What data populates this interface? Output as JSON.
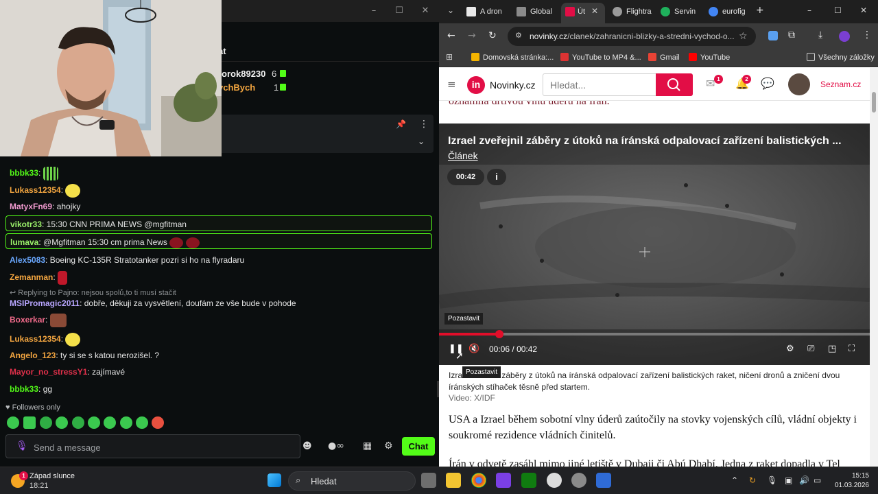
{
  "left_window": {
    "title_controls": [
      "–",
      "☐",
      "✕"
    ],
    "header_title": "at",
    "gifters": [
      {
        "name": "rorok89230",
        "count": "6",
        "color": "#f2f2f2"
      },
      {
        "name": "ychBych",
        "count": "1",
        "color": "#f4a640"
      }
    ],
    "messages": [
      {
        "user": "bbbk33",
        "color": "#53fc18",
        "text": "",
        "emote": "#6fd64a",
        "highlight": false
      },
      {
        "user": "Lukass12354",
        "color": "#f4a640",
        "text": "",
        "emote": "#f4e04a",
        "highlight": false
      },
      {
        "user": "MatyxFn69",
        "color": "#f29bd0",
        "text": "ahojky",
        "emote": "",
        "highlight": false
      },
      {
        "user": "vikotr33",
        "color": "#9cf26b",
        "text": "15:30 CNN PRIMA NEWS @mgfitman",
        "emote": "",
        "highlight": true
      },
      {
        "user": "lumava",
        "color": "#9cf26b",
        "text": "@Mgfitman 15:30 cm prima News",
        "emote": "#8a1420",
        "highlight": true
      },
      {
        "user": "Alex5083",
        "color": "#6aa8ff",
        "text": "Boeing KC-135R Stratotanker pozri si ho na flyradaru",
        "emote": "",
        "highlight": false
      },
      {
        "user": "Zemanman",
        "color": "#f4a640",
        "text": "",
        "emote": "#c0182a",
        "highlight": false
      },
      {
        "user": "MSIPromagic2011",
        "color": "#b8a6ff",
        "text": "dobře, děkuji za vysvětlení, doufám ze vše bude v pohode",
        "emote": "",
        "highlight": false,
        "reply": "Replying to Pajno: nejsou spolů,to ti musí stačit"
      },
      {
        "user": "Boxerkar",
        "color": "#f06a8a",
        "text": "",
        "emote": "#8a4a36",
        "highlight": false
      },
      {
        "user": "Lukass12354",
        "color": "#f4a640",
        "text": "",
        "emote": "#f4e04a",
        "highlight": false
      },
      {
        "user": "Angelo_123",
        "color": "#f4a640",
        "text": "ty si se s katou nerozišel. ?",
        "emote": "",
        "highlight": false
      },
      {
        "user": "Mayor_no_stressY1",
        "color": "#e0304a",
        "text": "zajímavé",
        "emote": "",
        "highlight": false
      },
      {
        "user": "bbbk33",
        "color": "#53fc18",
        "text": "gg",
        "emote": "",
        "highlight": false
      }
    ],
    "followers_only": "Followers only",
    "message_placeholder": "Send a message",
    "chat_button": "Chat",
    "accent": "#53fc18"
  },
  "browser": {
    "tabs": [
      {
        "label": "A dron",
        "fav": "#e8e8e8",
        "active": false
      },
      {
        "label": "Global",
        "fav": "#8a8a8a",
        "active": false
      },
      {
        "label": "Út",
        "fav": "#e20e46",
        "active": true
      },
      {
        "label": "Flightra",
        "fav": "#9a9a9a",
        "active": false
      },
      {
        "label": "Servin",
        "fav": "#1fb15c",
        "active": false
      },
      {
        "label": "eurofig",
        "fav": "#4285f4",
        "active": false
      }
    ],
    "new_tab": "+",
    "window_controls": [
      "–",
      "☐",
      "✕"
    ],
    "url_domain": "novinky.cz",
    "url_path": "/clanek/zahranicni-blizky-a-stredni-vychod-o...",
    "bookmarks": [
      {
        "label": "Domovská stránka:...",
        "color": "#f4b400"
      },
      {
        "label": "YouTube to MP4 &...",
        "color": "#d33"
      },
      {
        "label": "Gmail",
        "color": "#ea4335"
      },
      {
        "label": "YouTube",
        "color": "#ff0000"
      }
    ],
    "all_bookmarks": "Všechny záložky"
  },
  "page": {
    "logo_mark": "in",
    "logo_text": "Novinky.cz",
    "search_placeholder": "Hledat...",
    "mail_badge": "1",
    "bell_badge": "2",
    "seznam": "Seznam.cz",
    "prev_line": "oznámila drtivou vlnu úderů na Írán.",
    "video": {
      "title": "Izrael zveřejnil záběry z útoků na íránská odpalovací zařízení balistických ...",
      "link": "Článek",
      "duration_pill": "00:42",
      "info": "i",
      "tooltip": "Pozastavit",
      "current": "00:06",
      "sep": "/",
      "total": "00:42",
      "progress": 0.14
    },
    "caption": "Izrael zveřejnil záběry z útoků na íránská odpalovací zařízení balistických raket, ničení dronů a zničení dvou íránských stíhaček těsně před startem.",
    "caption_prefix": "Izra",
    "caption_rest": "záběry z útoků na íránská odpalovací zařízení balistických raket, ničení dronů a zničení dvou íránských stíhaček těsně před startem.",
    "credit": "Video: X/IDF",
    "tooltip_bottom": "Pozastavit",
    "para1": "USA a Izrael během sobotní vlny úderů zaútočily na stovky vojenských cílů, vládní objekty i soukromé rezidence vládních činitelů.",
    "para2": "Írán v odvetě zasáhl mimo jiné letiště v Dubaji či Abú Dhabí. Jedna z raket dopadla v Tel",
    "accent": "#e20e46"
  },
  "taskbar": {
    "weather_title": "Západ slunce",
    "weather_time": "18:21",
    "weather_badge": "1",
    "search_label": "Hledat",
    "time": "15:15",
    "date": "01.03.2026"
  }
}
